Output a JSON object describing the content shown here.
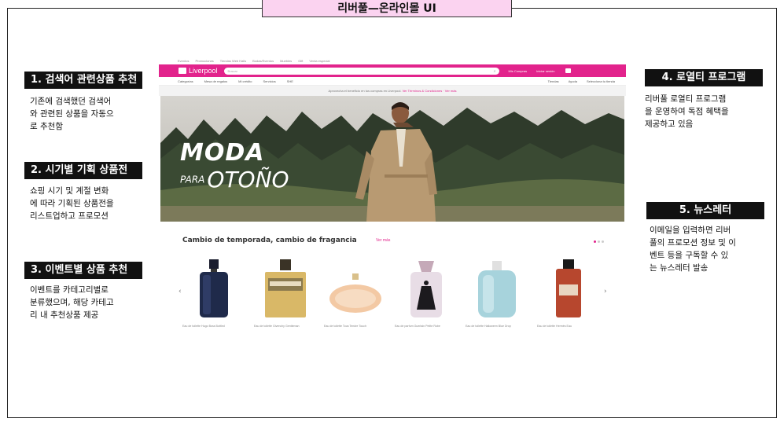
{
  "title": "리버풀—온라인몰 UI",
  "annotations": {
    "left": [
      {
        "heading": "1. 검색어 관련상품 추천",
        "body": [
          "기존에 검색했던 검색어",
          "와 관련된 상품을 자동으",
          "로 추천함"
        ]
      },
      {
        "heading": "2. 시기별 기획 상품전",
        "body": [
          "쇼핑 시기 및 계절 변화",
          "에 따라 기획된 상품전을",
          "리스트업하고 프로모션"
        ]
      },
      {
        "heading": "3. 이벤트별 상품 추천",
        "body": [
          "이벤트를  카테고리별로",
          "분류했으며, 해당 카테고",
          "리 내 추천상품 제공"
        ]
      }
    ],
    "right": [
      {
        "heading": "4. 로열티 프로그램",
        "body": [
          "리버풀 로열티 프로그램",
          "을 운영하여 독점 혜택을",
          "제공하고 있음"
        ]
      },
      {
        "heading": "5. 뉴스레터",
        "body": [
          "이메일을 입력하면 리버",
          "풀의 프로모션 정보 및 이",
          "벤트 등을 구독할 수 있",
          "는 뉴스레터 발송"
        ]
      }
    ]
  },
  "site": {
    "top_links": [
      "Eventos",
      "Promociones",
      "Tiendas Web Halls",
      "Bodas/Eventos",
      "Muebles",
      "Gift",
      "Venta especial"
    ],
    "logo": "Liverpool",
    "search_placeholder": "Buscar",
    "header_links": [
      "Mis Compras",
      "Iniciar sesión"
    ],
    "nav_left": [
      "Categorías",
      "Mesa de regalos",
      "Mi crédito",
      "Servicios",
      "SHE"
    ],
    "nav_right": [
      "Tiendas",
      "Ayuda",
      "Selecciona tu tienda"
    ],
    "promo_text": "Aprovecha el beneficio en tus compras en Liverpool. ",
    "promo_link": "Ver Términos & Condiciones · Ver más",
    "hero_line1": "MODA",
    "hero_para": "PARA",
    "hero_line2": "OTOÑO",
    "section_title": "Cambio de temporada, cambio de fragancia",
    "section_link": "Ver más",
    "products": [
      "Eau de toilette Hugo Boss Bottled",
      "Eau de toilette Givenchy Gentleman",
      "Eau de toilette Tous Tendre Touch",
      "Eau de parfum Guerlain Petite Robe",
      "Eau de toilette Halloween Blue Drop",
      "Eau de toilette Hermès Eau"
    ],
    "prev_arrow": "‹",
    "next_arrow": "›"
  },
  "colors": {
    "accent": "#e2238c",
    "title_tab": "#fbd3f0",
    "annotation_bg": "#111111"
  }
}
